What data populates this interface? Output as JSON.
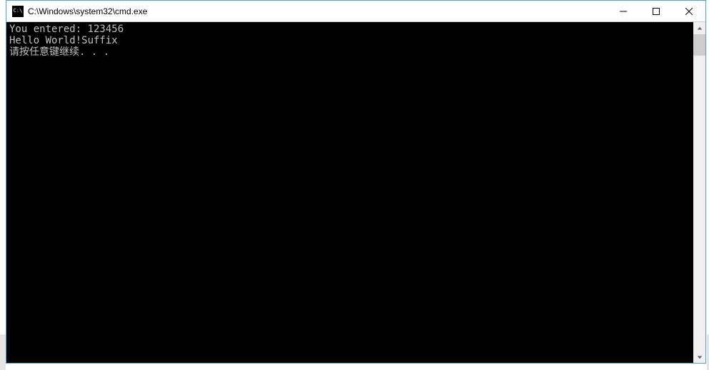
{
  "window": {
    "title": "C:\\Windows\\system32\\cmd.exe"
  },
  "console": {
    "lines": [
      "You entered: 123456",
      "Hello World!Suffix",
      "请按任意键继续. . ."
    ]
  }
}
